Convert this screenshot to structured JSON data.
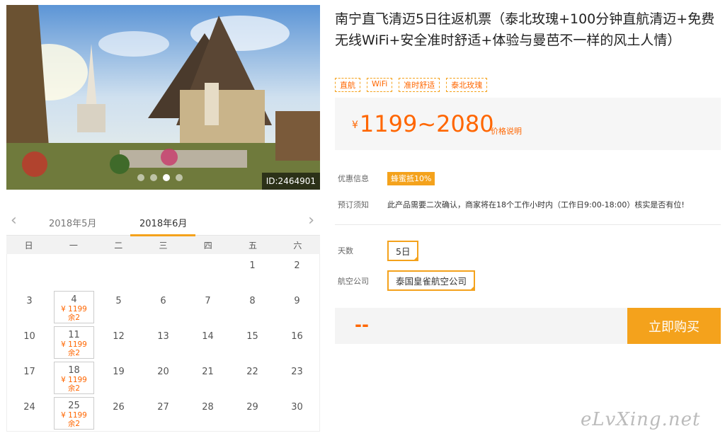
{
  "hero": {
    "image_id": "ID:2464901",
    "slide_count": 4,
    "active_slide": 3
  },
  "calendar": {
    "prev_month": "2018年5月",
    "current_month": "2018年6月",
    "weekdays": [
      "日",
      "一",
      "二",
      "三",
      "四",
      "五",
      "六"
    ],
    "leading_blanks": 5,
    "days": [
      {
        "d": "1"
      },
      {
        "d": "2"
      },
      {
        "d": "3"
      },
      {
        "d": "4",
        "price": "¥ 1199",
        "stock": "余2"
      },
      {
        "d": "5"
      },
      {
        "d": "6"
      },
      {
        "d": "7"
      },
      {
        "d": "8"
      },
      {
        "d": "9"
      },
      {
        "d": "10"
      },
      {
        "d": "11",
        "price": "¥ 1199",
        "stock": "余2"
      },
      {
        "d": "12"
      },
      {
        "d": "13"
      },
      {
        "d": "14"
      },
      {
        "d": "15"
      },
      {
        "d": "16"
      },
      {
        "d": "17"
      },
      {
        "d": "18",
        "price": "¥ 1199",
        "stock": "余2"
      },
      {
        "d": "19"
      },
      {
        "d": "20"
      },
      {
        "d": "21"
      },
      {
        "d": "22"
      },
      {
        "d": "23"
      },
      {
        "d": "24"
      },
      {
        "d": "25",
        "price": "¥ 1199",
        "stock": "余2"
      },
      {
        "d": "26"
      },
      {
        "d": "27"
      },
      {
        "d": "28"
      },
      {
        "d": "29"
      },
      {
        "d": "30"
      }
    ]
  },
  "product": {
    "title": "南宁直飞清迈5日往返机票（泰北玫瑰+100分钟直航清迈+免费无线WiFi+安全准时舒适+体验与曼芭不一样的风土人情）",
    "tags": [
      "直航",
      "WiFi",
      "准时舒适",
      "泰北玫瑰"
    ],
    "price_currency": "¥",
    "price_range": "1199~2080",
    "price_explain": "价格说明"
  },
  "info": {
    "promo_label": "优惠信息",
    "promo_badge": "蜂蜜抵10%",
    "notice_label": "预订须知",
    "notice_text": "此产品需要二次确认，商家将在18个工作小时内（工作日9:00-18:00）核实是否有位!"
  },
  "options": {
    "days_label": "天数",
    "days_value": "5日",
    "airline_label": "航空公司",
    "airline_value": "泰国皇雀航空公司"
  },
  "buy": {
    "total": "--",
    "button": "立即购买"
  },
  "watermark": "eLvXing.net",
  "colors": {
    "accent": "#f4a21c",
    "price": "#ff6600"
  }
}
